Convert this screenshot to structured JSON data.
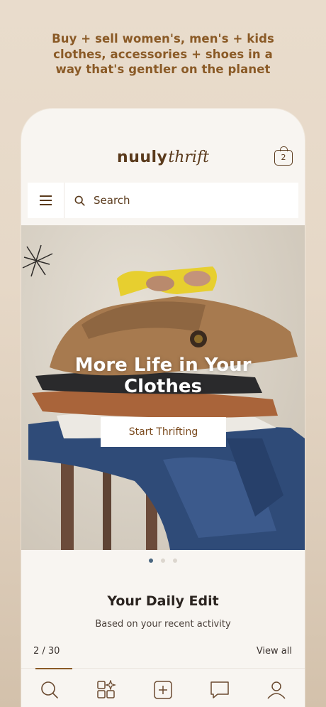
{
  "tagline": {
    "line1": "Buy + sell women's, men's + kids",
    "line2": "clothes, accessories + shoes in a",
    "line3": "way that's gentler on the planet"
  },
  "header": {
    "logo_brand": "nuuly",
    "logo_sub": "thrift",
    "cart_count": "2"
  },
  "search": {
    "placeholder": "Search"
  },
  "hero": {
    "title_line1": "More Life in Your",
    "title_line2": "Clothes",
    "cta_label": "Start Thrifting",
    "carousel_total": 3,
    "carousel_active": 1
  },
  "daily_edit": {
    "title": "Your Daily Edit",
    "subtitle": "Based on your recent activity",
    "pager": "2 / 30",
    "view_all": "View all"
  },
  "tabbar": {
    "items": [
      "search-icon",
      "categories-icon",
      "sell-icon",
      "messages-icon",
      "profile-icon"
    ],
    "active": 0
  },
  "colors": {
    "brand_brown": "#8a5a26",
    "logo_brown": "#5a3a1c",
    "dot_active": "#4a6680",
    "background": "#e9dccc"
  }
}
